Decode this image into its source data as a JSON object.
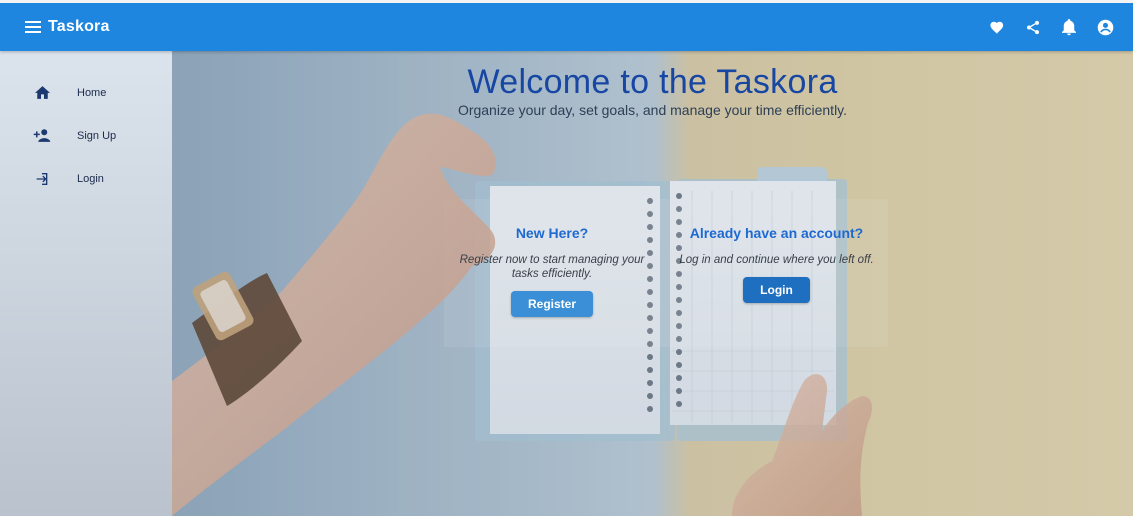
{
  "appbar": {
    "title": "Taskora",
    "icons": [
      "menu-icon",
      "heart-icon",
      "share-icon",
      "bell-icon",
      "account-circle-icon"
    ],
    "color": "#1f86e0"
  },
  "sidebar": {
    "items": [
      {
        "label": "Home",
        "icon": "home-icon"
      },
      {
        "label": "Sign Up",
        "icon": "person-add-icon"
      },
      {
        "label": "Login",
        "icon": "login-icon"
      }
    ]
  },
  "hero": {
    "title": "Welcome to the Taskora",
    "subtitle": "Organize your day, set goals, and manage your time efficiently."
  },
  "cards": {
    "register": {
      "title": "New Here?",
      "text": "Register now to start managing your tasks efficiently.",
      "button": "Register"
    },
    "login": {
      "title": "Already have an account?",
      "text": "Log in and continue where you left off.",
      "button": "Login"
    }
  },
  "colors": {
    "accent": "#1f86e0",
    "title_blue": "#1747a3",
    "register_button": "#3a8fd6",
    "login_button": "#1f6fc1"
  }
}
